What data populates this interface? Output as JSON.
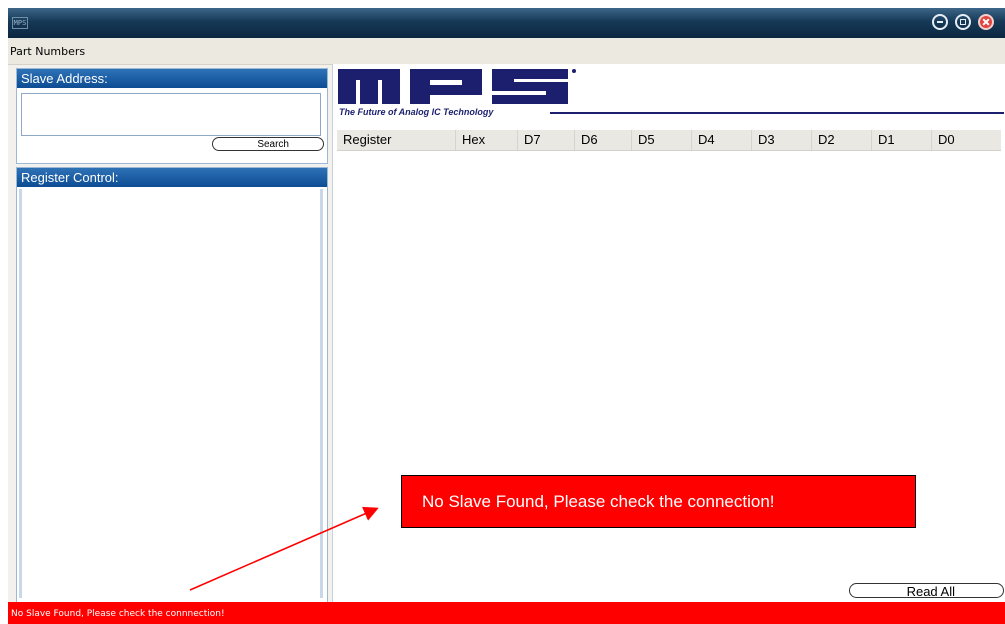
{
  "window": {
    "icon_text": "MPS"
  },
  "menu": {
    "part_numbers": "Part Numbers"
  },
  "slave_panel": {
    "title": "Slave Address:",
    "address_value": "",
    "search_label": "Search"
  },
  "register_panel": {
    "title": "Register Control:"
  },
  "logo": {
    "text": "MPS",
    "tagline": "The Future of Analog IC Technology"
  },
  "table": {
    "columns": [
      "Register",
      "Hex",
      "D7",
      "D6",
      "D5",
      "D4",
      "D3",
      "D2",
      "D1",
      "D0"
    ]
  },
  "buttons": {
    "read_all": "Read All"
  },
  "status": {
    "message": "No Slave Found, Please check the connnection!"
  },
  "callout": {
    "message": "No Slave Found, Please check the connection!"
  },
  "colors": {
    "error": "#ff0000",
    "header_blue": "#0d4c93",
    "logo_navy": "#1c1f6e"
  }
}
